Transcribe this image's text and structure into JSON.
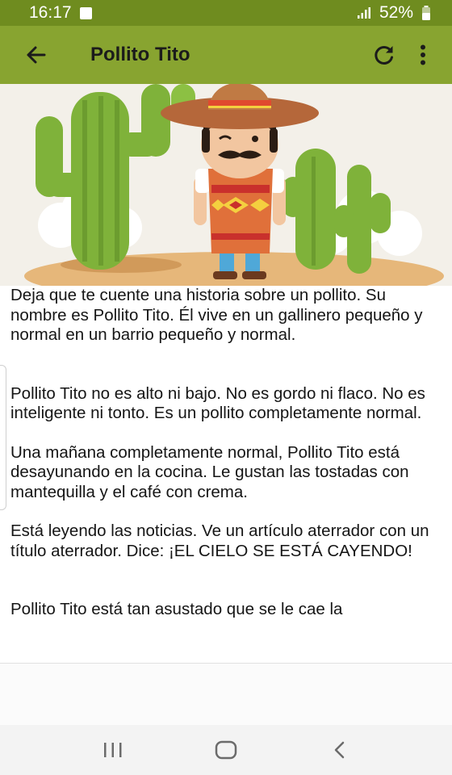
{
  "status_bar": {
    "time": "16:17",
    "battery": "52%",
    "icons": [
      "notification-icon",
      "signal-icon",
      "battery-icon"
    ]
  },
  "toolbar": {
    "title": "Pollito Tito",
    "icons": [
      "back-arrow-icon",
      "refresh-icon",
      "more-vert-icon"
    ]
  },
  "hero": {
    "description_icons": [
      "cactus",
      "sombrero",
      "mustache",
      "poncho"
    ]
  },
  "story": {
    "paragraphs": [
      "Deja que te cuente una historia sobre un pollito. Su nombre es Pollito Tito. Él vive en un gallinero pequeño y normal en un barrio pequeño y normal.",
      "Pollito Tito no es alto ni bajo. No es gordo ni flaco. No es inteligente ni tonto. Es un pollito completamente normal.",
      "Una mañana completamente normal, Pollito Tito está desayunando en la cocina. Le gustan las tostadas con mantequilla y el café con crema.",
      "Está leyendo las noticias. Ve un artículo aterrador con un título aterrador. Dice: ¡EL CIELO SE ESTÁ CAYENDO!",
      "Pollito Tito está tan asustado que se le cae la"
    ]
  },
  "nav_bar": {
    "icons": [
      "recent-apps-icon",
      "home-icon",
      "back-icon"
    ]
  },
  "colors": {
    "status_bar": "#6f8c1f",
    "toolbar": "#88a430",
    "text": "#151515"
  }
}
